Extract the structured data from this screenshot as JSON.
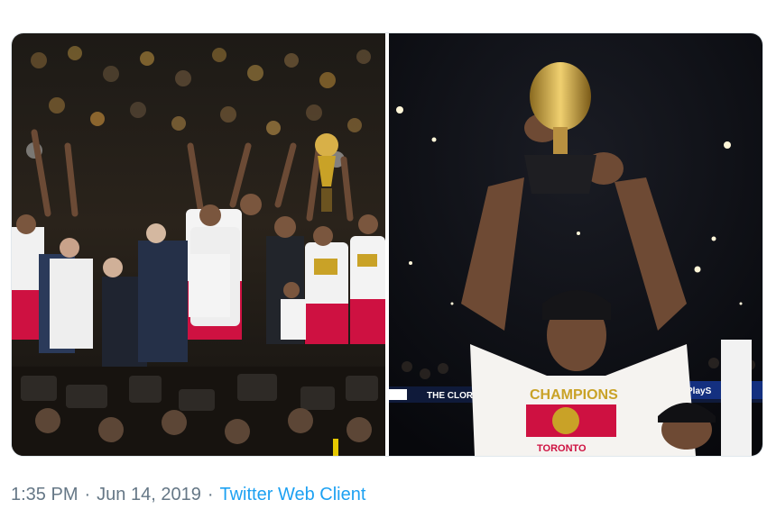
{
  "tweet": {
    "time": "1:35 PM",
    "date": "Jun 14, 2019",
    "separator": "·",
    "client": "Twitter Web Client"
  },
  "photos": {
    "right": {
      "banner_left": "THE CLOROX",
      "banner_right": "PlayS",
      "shirt_top": "CHAMPIONS",
      "shirt_bottom": "TORONTO"
    }
  },
  "colors": {
    "link": "#1da1f2",
    "meta": "#657786",
    "raptors_red": "#ce1141",
    "gold": "#c9a227"
  }
}
